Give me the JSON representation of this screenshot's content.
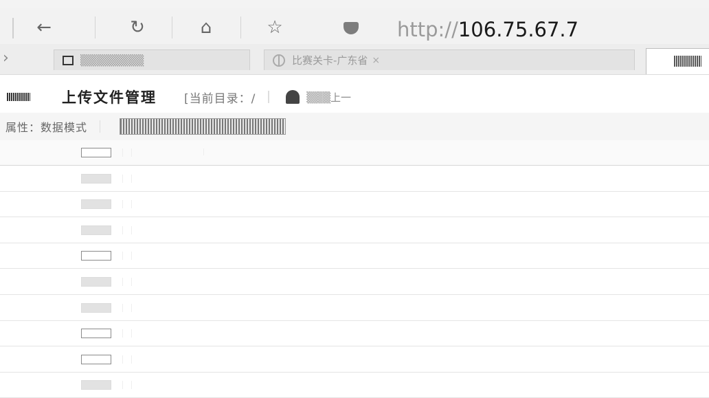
{
  "browser": {
    "url": "http://106.75.67.7",
    "url_scheme": "http://",
    "url_host": "106.75.67.7",
    "nav": {
      "back_icon": "back-arrow-icon",
      "reload_icon": "reload-icon",
      "home_icon": "home-icon",
      "bookmark_icon": "star-icon",
      "security_icon": "shield-icon"
    },
    "tabs": [
      {
        "label": "▒▒▒▒▒▒▒▒",
        "icon": "page-icon"
      },
      {
        "label": "比赛关卡-广东省",
        "icon": "globe-icon",
        "close": "×"
      }
    ]
  },
  "header": {
    "title": "上传文件管理",
    "current_dir": "[当前目录：/",
    "go_up": "▒▒▒上一"
  },
  "toolbar": {
    "mode_label": "属性：数据模式"
  },
  "file_list": {
    "rows": [
      {
        "checked": false,
        "style": "outline"
      },
      {
        "checked": false,
        "style": "filled"
      },
      {
        "checked": false,
        "style": "filled"
      },
      {
        "checked": false,
        "style": "filled"
      },
      {
        "checked": false,
        "style": "outline"
      },
      {
        "checked": false,
        "style": "filled"
      },
      {
        "checked": false,
        "style": "filled"
      },
      {
        "checked": false,
        "style": "outline"
      },
      {
        "checked": false,
        "style": "outline"
      },
      {
        "checked": false,
        "style": "filled"
      }
    ]
  },
  "colors": {
    "chrome_bg": "#f2f2f2",
    "tab_bar_bg": "#ededed",
    "row_border": "#e4e4e4",
    "text_dark": "#222222",
    "text_muted": "#9a9a9a"
  }
}
